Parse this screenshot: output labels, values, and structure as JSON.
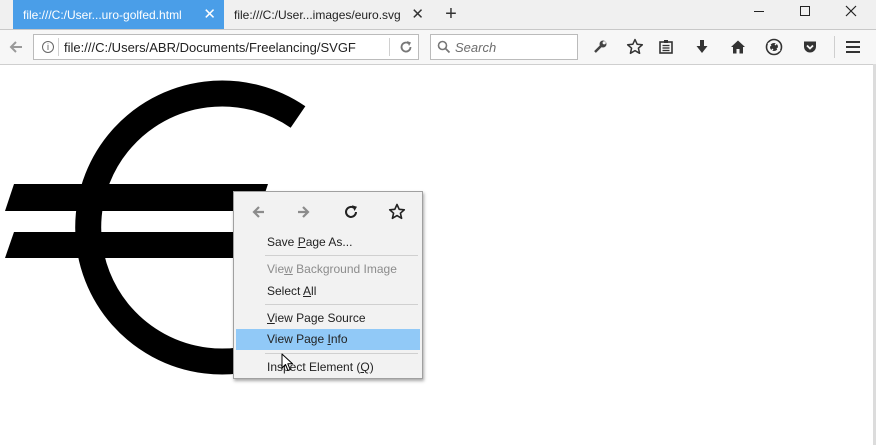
{
  "tabs": [
    {
      "title": "file:///C:/User...uro-golfed.html",
      "active": true
    },
    {
      "title": "file:///C:/User...images/euro.svg",
      "active": false
    }
  ],
  "new_tab_icon": "plus-icon",
  "window_controls": {
    "minimize": "minimize-icon",
    "maximize": "maximize-icon",
    "close": "close-icon"
  },
  "navbar": {
    "url": "file:///C:/Users/ABR/Documents/Freelancing/SVGF",
    "search_placeholder": "Search",
    "icons": [
      "back-icon",
      "info-icon",
      "reload-icon",
      "search-icon",
      "wrench-icon",
      "bookmark-star-icon",
      "reading-list-icon",
      "download-icon",
      "home-icon",
      "sync-icon",
      "pocket-icon",
      "menu-icon"
    ]
  },
  "page": {
    "symbol": "€",
    "symbol_color": "#000000"
  },
  "context_menu": {
    "nav_icons": [
      "back-arrow-icon",
      "forward-arrow-icon",
      "reload-icon",
      "bookmark-star-icon"
    ],
    "items": [
      {
        "before": "Save ",
        "key": "P",
        "after": "age As...",
        "state": "normal"
      },
      {
        "before": "Vie",
        "key": "w",
        "after": " Background Image",
        "state": "disabled"
      },
      {
        "before": "Select ",
        "key": "A",
        "after": "ll",
        "state": "normal"
      },
      {
        "before": "",
        "key": "V",
        "after": "iew Page Source",
        "state": "normal"
      },
      {
        "before": "View Page ",
        "key": "I",
        "after": "nfo",
        "state": "highlighted"
      },
      {
        "before": "Inspect Element (",
        "key": "Q",
        "after": ")",
        "state": "normal"
      }
    ]
  },
  "colors": {
    "active_tab": "#4a9ee8",
    "menu_highlight": "#91c9f7",
    "menu_bg": "#f2f2f2"
  }
}
